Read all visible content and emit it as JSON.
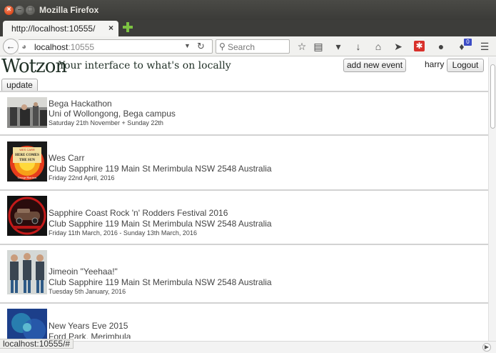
{
  "window": {
    "title": "Mozilla Firefox",
    "tab_title": "http://localhost:10555/",
    "tab_close": "×"
  },
  "nav": {
    "url_host": "localhost",
    "url_port": ":10555",
    "search_placeholder": "Search",
    "notification_count": "0"
  },
  "header": {
    "logo": "Wotzon",
    "tagline": "Your interface to what's on locally",
    "add_event_label": "add new event",
    "username": "harry",
    "logout_label": "Logout",
    "update_label": "update"
  },
  "events": [
    {
      "title": "Bega Hackathon",
      "venue": "Uni of Wollongong, Bega campus",
      "date": "Saturday 21th November + Sunday 22th"
    },
    {
      "title": "Wes Carr",
      "venue": "Club Sapphire 119 Main St Merimbula NSW 2548 Australia",
      "date": "Friday 22nd April, 2016",
      "poster_text": [
        "WES CARR",
        "HERE COMES",
        "THE SUN",
        "George Harrison"
      ]
    },
    {
      "title": "Sapphire Coast Rock 'n' Rodders Festival 2016",
      "venue": "Club Sapphire 119 Main St Merimbula NSW 2548 Australia",
      "date": "Friday 11th March, 2016 - Sunday 13th March, 2016"
    },
    {
      "title": "Jimeoin \"Yeehaa!\"",
      "venue": "Club Sapphire 119 Main St Merimbula NSW 2548 Australia",
      "date": "Tuesday 5th January, 2016"
    },
    {
      "title": "New Years Eve 2015",
      "venue": "Ford Park, Merimbula",
      "date": ""
    }
  ],
  "status_bar": {
    "text": "localhost:10555/#"
  },
  "colors": {
    "titlebar": "#3b3b38",
    "close_button": "#df4a1c",
    "newtab_plus": "#7cc242",
    "logo_text": "#1f2f25",
    "event_text": "#444444",
    "divider": "#d2d2d2"
  }
}
